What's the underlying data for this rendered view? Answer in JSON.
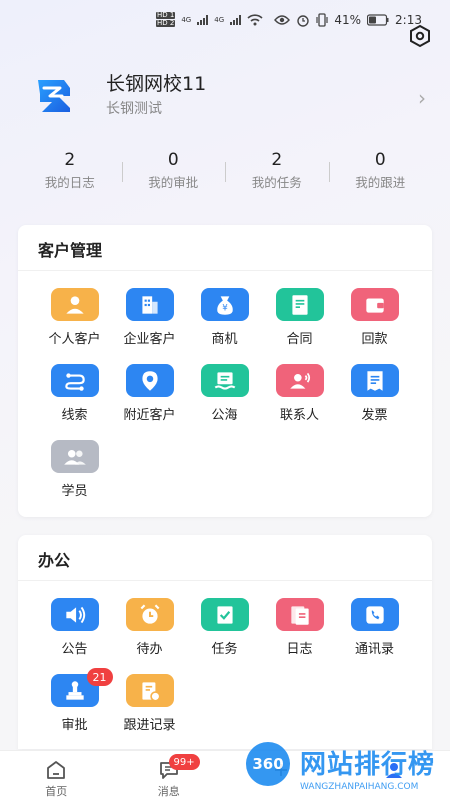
{
  "status_bar": {
    "battery": "41%",
    "time": "2:13",
    "sim1": "HD 1",
    "sim2": "HD 2",
    "net": "4G"
  },
  "profile": {
    "name": "长钢网校11",
    "subtitle": "长钢测试"
  },
  "stats": [
    {
      "value": "2",
      "label": "我的日志"
    },
    {
      "value": "0",
      "label": "我的审批"
    },
    {
      "value": "2",
      "label": "我的任务"
    },
    {
      "value": "0",
      "label": "我的跟进"
    }
  ],
  "customer_section": {
    "title": "客户管理",
    "items": [
      {
        "label": "个人客户",
        "icon": "person-icon",
        "color": "#f7b24a"
      },
      {
        "label": "企业客户",
        "icon": "building-icon",
        "color": "#2d86f2"
      },
      {
        "label": "商机",
        "icon": "money-bag-icon",
        "color": "#2d86f2"
      },
      {
        "label": "合同",
        "icon": "contract-icon",
        "color": "#22c49a"
      },
      {
        "label": "回款",
        "icon": "wallet-icon",
        "color": "#f0637a"
      },
      {
        "label": "线索",
        "icon": "route-icon",
        "color": "#2d86f2"
      },
      {
        "label": "附近客户",
        "icon": "location-icon",
        "color": "#2d86f2"
      },
      {
        "label": "公海",
        "icon": "sea-icon",
        "color": "#22c49a"
      },
      {
        "label": "联系人",
        "icon": "contact-icon",
        "color": "#f0637a"
      },
      {
        "label": "发票",
        "icon": "invoice-icon",
        "color": "#2d86f2"
      },
      {
        "label": "学员",
        "icon": "students-icon",
        "color": "#b6bac4"
      }
    ]
  },
  "office_section": {
    "title": "办公",
    "items": [
      {
        "label": "公告",
        "icon": "speaker-icon",
        "color": "#2d86f2"
      },
      {
        "label": "待办",
        "icon": "alarm-icon",
        "color": "#f7b24a"
      },
      {
        "label": "任务",
        "icon": "task-icon",
        "color": "#22c49a"
      },
      {
        "label": "日志",
        "icon": "log-icon",
        "color": "#f0637a"
      },
      {
        "label": "通讯录",
        "icon": "phone-icon",
        "color": "#2d86f2"
      },
      {
        "label": "审批",
        "icon": "stamp-icon",
        "color": "#2d86f2",
        "badge": "21"
      },
      {
        "label": "跟进记录",
        "icon": "followup-icon",
        "color": "#f7b24a"
      }
    ]
  },
  "tabbar": {
    "tabs": [
      {
        "label": "首页",
        "icon": "home-icon"
      },
      {
        "label": "消息",
        "icon": "message-icon",
        "badge": "99+"
      },
      {
        "label": "",
        "icon": "plus-icon"
      },
      {
        "label": "",
        "icon": "profile-tab-icon"
      }
    ]
  },
  "watermark": {
    "circle": "360",
    "text": "网站排行榜",
    "url": "WANGZHANPAIHANG.COM"
  }
}
